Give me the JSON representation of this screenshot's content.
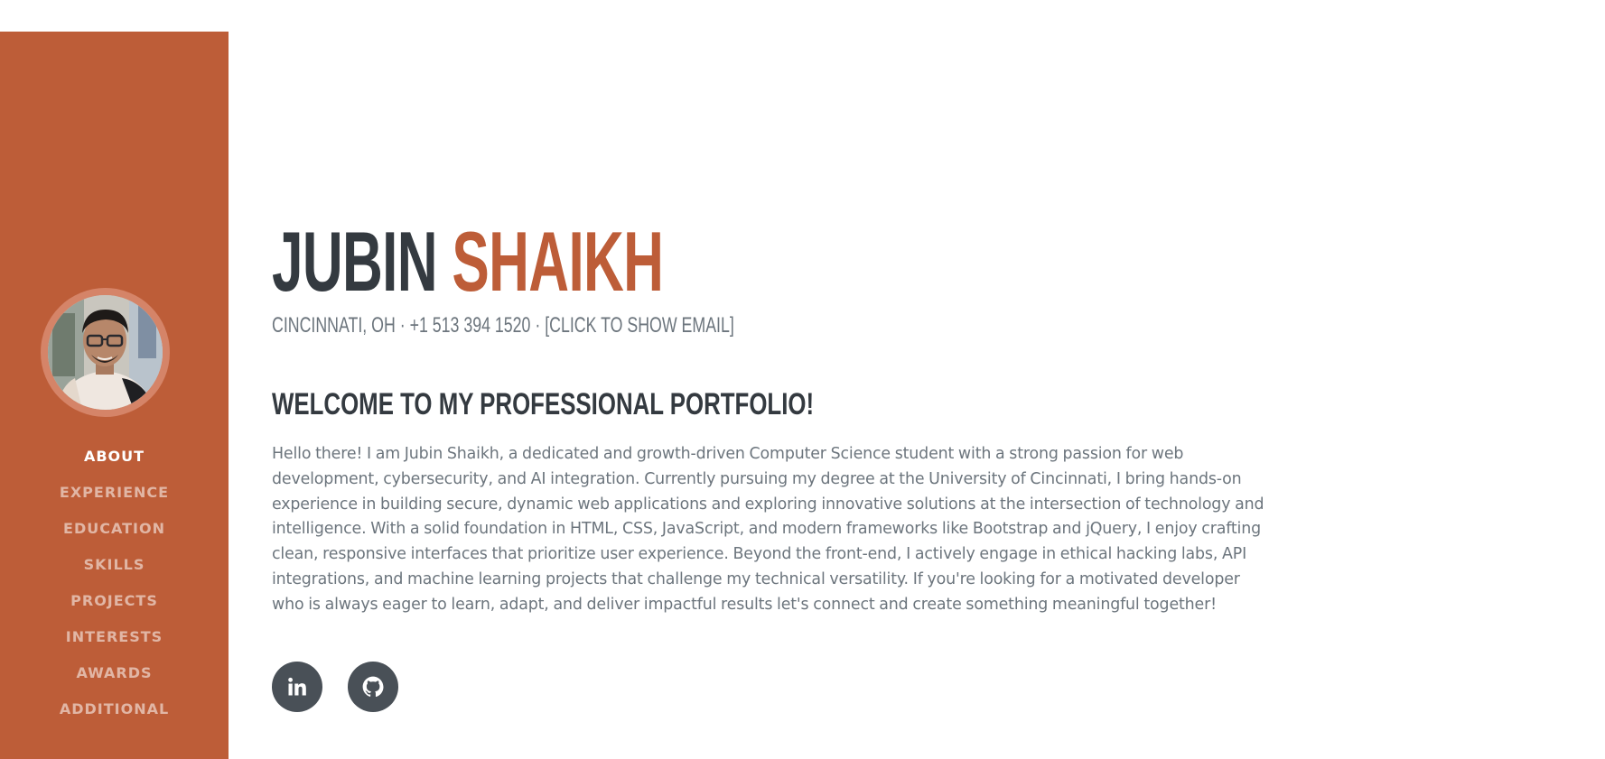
{
  "sidebar": {
    "avatar_alt": "profile photo",
    "nav": [
      {
        "label": "ABOUT",
        "active": true
      },
      {
        "label": "EXPERIENCE",
        "active": false
      },
      {
        "label": "EDUCATION",
        "active": false
      },
      {
        "label": "SKILLS",
        "active": false
      },
      {
        "label": "PROJECTS",
        "active": false
      },
      {
        "label": "INTERESTS",
        "active": false
      },
      {
        "label": "AWARDS",
        "active": false
      },
      {
        "label": "ADDITIONAL",
        "active": false
      }
    ]
  },
  "header": {
    "first_name": "JUBIN",
    "last_name": "SHAIKH",
    "location": "CINCINNATI, OH",
    "separator": "·",
    "phone": "+1 513 394 1520",
    "email_link": "[CLICK TO SHOW EMAIL]"
  },
  "about": {
    "heading": "WELCOME TO MY PROFESSIONAL PORTFOLIO!",
    "text": "Hello there! I am Jubin Shaikh, a dedicated and growth-driven Computer Science student with a strong passion for web development, cybersecurity, and AI integration. Currently pursuing my degree at the University of Cincinnati, I bring hands-on experience in building secure, dynamic web applications and exploring innovative solutions at the intersection of technology and intelligence. With a solid foundation in HTML, CSS, JavaScript, and modern frameworks like Bootstrap and jQuery, I enjoy crafting clean, responsive interfaces that prioritize user experience. Beyond the front-end, I actively engage in ethical hacking labs, API integrations, and machine learning projects that challenge my technical versatility. If you're looking for a motivated developer who is always eager to learn, adapt, and deliver impactful results let's connect and create something meaningful together!"
  },
  "socials": [
    {
      "name": "linkedin-icon"
    },
    {
      "name": "github-icon"
    }
  ],
  "colors": {
    "accent": "#bd5d38",
    "dark": "#343a40",
    "muted": "#6c757d",
    "social_bg": "#495057"
  }
}
